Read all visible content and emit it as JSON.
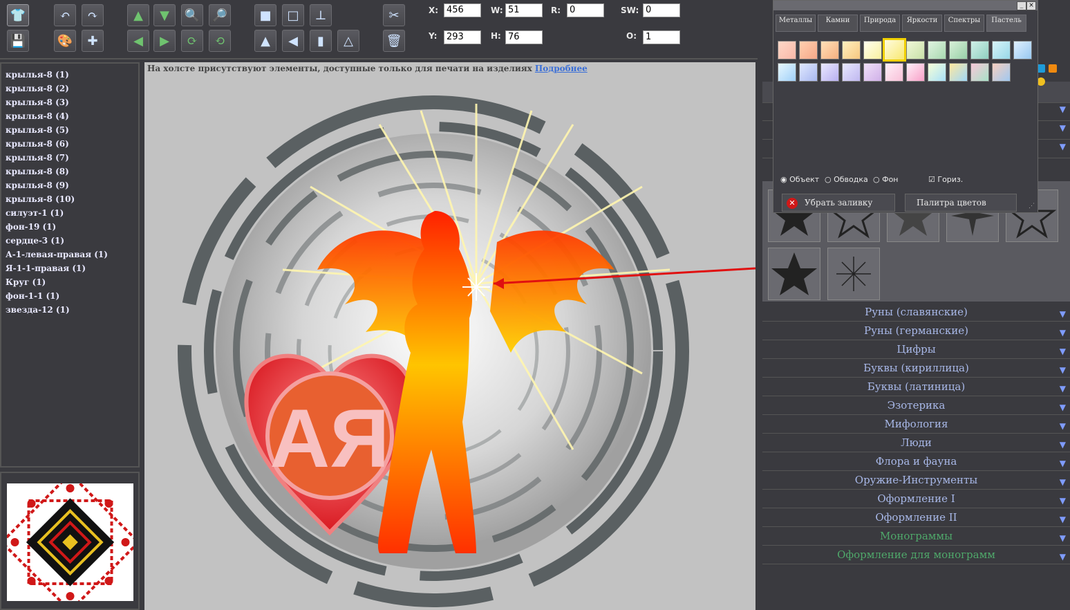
{
  "fields": {
    "x_label": "X:",
    "x_value": "456",
    "y_label": "Y:",
    "y_value": "293",
    "w_label": "W:",
    "w_value": "51",
    "h_label": "H:",
    "h_value": "76",
    "r_label": "R:",
    "r_value": "0",
    "sw_label": "SW:",
    "sw_value": "0",
    "o_label": "O:",
    "o_value": "1"
  },
  "layers": [
    "крылья-8 (1)",
    "крылья-8 (2)",
    "крылья-8 (3)",
    "крылья-8 (4)",
    "крылья-8 (5)",
    "крылья-8 (6)",
    "крылья-8 (7)",
    "крылья-8 (8)",
    "крылья-8 (9)",
    "крылья-8 (10)",
    "силуэт-1 (1)",
    "фон-19 (1)",
    "сердце-3 (1)",
    "А-1-левая-правая (1)",
    "Я-1-1-правая (1)",
    "Круг (1)",
    "фон-1-1 (1)",
    "звезда-12 (1)"
  ],
  "canvas": {
    "notice": "На холсте присутствуют элементы, доступные только для печати на изделиях",
    "notice_link": "Подробнее"
  },
  "palette": {
    "tabs": [
      "Металлы",
      "Камни",
      "Природа",
      "Яркости",
      "Спектры",
      "Пастель"
    ],
    "active_tab": "Пастель",
    "radio_object": "Объект",
    "radio_outline": "Обводка",
    "radio_bg": "Фон",
    "check_horiz": "Гориз.",
    "remove_fill": "Убрать заливку",
    "color_palette": "Палитра цветов",
    "swatches_row1": [
      [
        "#ffd8c8",
        "#f8b8a8"
      ],
      [
        "#ffd0b0",
        "#f6a888"
      ],
      [
        "#ffe0b8",
        "#f6b080"
      ],
      [
        "#fff0c0",
        "#f6c880"
      ],
      [
        "#fffff0",
        "#f8f0a0"
      ],
      [
        "#fffce0",
        "#f8e870"
      ],
      [
        "#f0f8d8",
        "#c8e0a8"
      ],
      [
        "#e0f4e0",
        "#a8d8b0"
      ],
      [
        "#d8f0d8",
        "#98d0a8"
      ],
      [
        "#d0f0e8",
        "#90d0c0"
      ],
      [
        "#d8f4f8",
        "#98d8e8"
      ],
      [
        "#e0f0ff",
        "#98c8f0"
      ]
    ],
    "swatches_row2": [
      [
        "#e8f8ff",
        "#a0d0f8"
      ],
      [
        "#e0e8ff",
        "#a8b8f0"
      ],
      [
        "#eae8ff",
        "#b8b0f0"
      ],
      [
        "#e8e8ff",
        "#c0b8f0"
      ],
      [
        "#f0e0f8",
        "#d0b0e8"
      ],
      [
        "#fff0f8",
        "#f8c0d8"
      ],
      [
        "#fff0f8",
        "#f8a0c8"
      ],
      [
        "#f8ffd8",
        "#a8e0f8"
      ],
      [
        "#ffe8a0",
        "#a0d8f8"
      ],
      [
        "#f8c8d8",
        "#a8e0c8"
      ],
      [
        "#f8d0c0",
        "#a0c8f0"
      ]
    ]
  },
  "categories": [
    "Руны (славянские)",
    "Руны (германские)",
    "Цифры",
    "Буквы (кириллица)",
    "Буквы (латиница)",
    "Эзотерика",
    "Мифология",
    "Люди",
    "Флора и фауна",
    "Оружие-Инструменты",
    "Оформление I",
    "Оформление II"
  ],
  "categories_green": [
    "Монограммы",
    "Оформление для монограмм"
  ],
  "icons": {
    "shirt": "shirt-icon",
    "save": "save-icon",
    "undo": "undo-icon",
    "redo": "redo-icon",
    "paint": "palette-icon",
    "add": "add-image-icon",
    "up": "arrow-up-icon",
    "down": "arrow-down-icon",
    "left": "arrow-left-icon",
    "right": "arrow-right-icon",
    "zoom_in": "zoom-in-icon",
    "zoom_out": "zoom-out-icon",
    "rotate_cw": "rotate-cw-icon",
    "rotate_ccw": "rotate-ccw-icon",
    "tools": "tools-icon",
    "trash": "trash-icon"
  }
}
